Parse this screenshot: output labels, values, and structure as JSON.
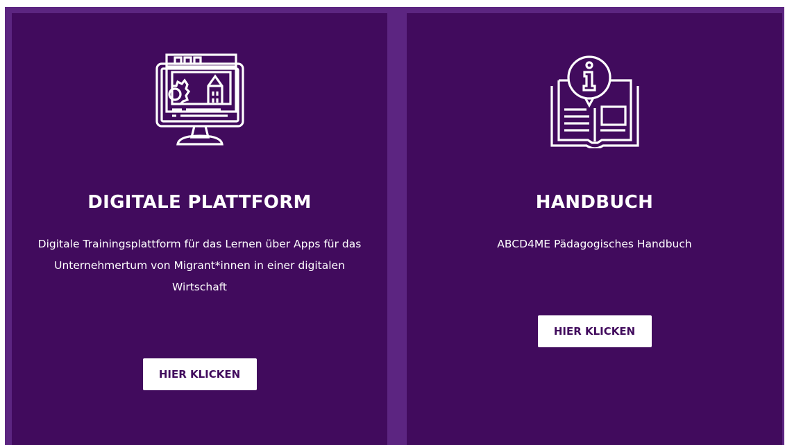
{
  "cards": [
    {
      "icon": "monitor-apps-icon",
      "title": "DIGITALE PLATTFORM",
      "description": "Digitale Trainingsplattform für das Lernen über Apps für das Unternehmertum von Migrant*innen in einer digitalen Wirtschaft",
      "button_label": "HIER KLICKEN"
    },
    {
      "icon": "info-book-icon",
      "title": "HANDBUCH",
      "description": "ABCD4ME Pädagogisches Handbuch",
      "button_label": "HIER KLICKEN"
    }
  ],
  "colors": {
    "frame": "#5c2581",
    "card": "#410b5d",
    "text": "#ffffff",
    "button_text": "#410b5d"
  }
}
